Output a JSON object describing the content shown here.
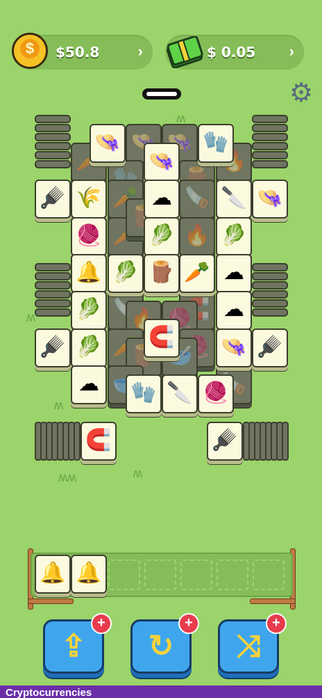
{
  "hud": {
    "coins": "$50.8",
    "cash": "$ 0.05",
    "coin_icon": "gold-dollar-coin",
    "cash_icon": "green-money-stack",
    "settings_icon": "gear"
  },
  "board": {
    "tiles_top": [
      "hat",
      "hat",
      "hat",
      "glove",
      "brush",
      "wheat",
      "cotton",
      "trowel",
      "hat",
      "yarn",
      "lettuce",
      "lettuce",
      "bell",
      "lettuce",
      "log",
      "carrot",
      "cotton",
      "lettuce",
      "cotton",
      "brush",
      "lettuce",
      "magnet",
      "hat",
      "brush",
      "cotton",
      "glove",
      "trowel",
      "yarn"
    ],
    "side_left_tile": "magnet",
    "side_right_tile": "brush"
  },
  "tray": {
    "tiles": [
      "bell",
      "bell"
    ],
    "slots": 7
  },
  "buttons": {
    "undo_icon": "arrow-up-box",
    "rotate_icon": "rotate-arrow",
    "shuffle_icon": "shuffle-arrows",
    "badge": "+"
  },
  "banner": {
    "text": "Cryptocurrencies"
  }
}
